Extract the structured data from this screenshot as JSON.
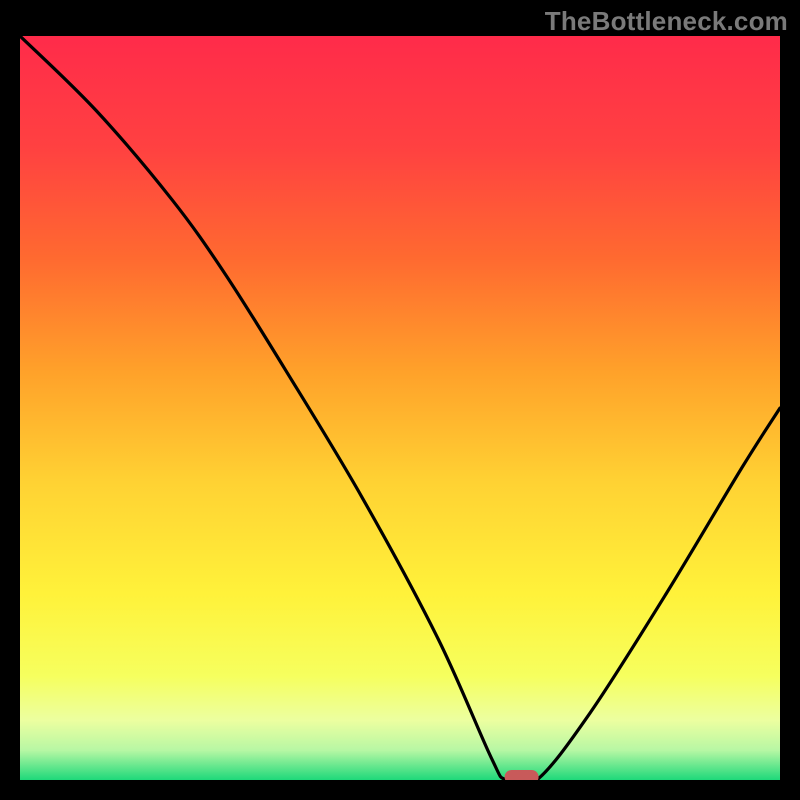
{
  "watermark": "TheBottleneck.com",
  "chart_data": {
    "type": "line",
    "title": "",
    "xlabel": "",
    "ylabel": "",
    "xlim": [
      0,
      100
    ],
    "ylim": [
      0,
      100
    ],
    "series": [
      {
        "name": "curve",
        "x": [
          0,
          10,
          20,
          27,
          35,
          45,
          55,
          62,
          64,
          68,
          75,
          85,
          95,
          100
        ],
        "values": [
          100,
          90,
          78,
          68,
          55,
          38,
          19,
          3,
          0,
          0,
          9,
          25,
          42,
          50
        ]
      }
    ],
    "marker": {
      "x": 66,
      "y": 0,
      "color": "#c85a5a"
    },
    "gradient": {
      "stops": [
        {
          "offset": 0,
          "color": "#ff2b4a"
        },
        {
          "offset": 0.15,
          "color": "#ff4141"
        },
        {
          "offset": 0.3,
          "color": "#ff6a30"
        },
        {
          "offset": 0.45,
          "color": "#ffa12a"
        },
        {
          "offset": 0.6,
          "color": "#ffd233"
        },
        {
          "offset": 0.75,
          "color": "#fff23a"
        },
        {
          "offset": 0.86,
          "color": "#f6ff5e"
        },
        {
          "offset": 0.92,
          "color": "#ecffa0"
        },
        {
          "offset": 0.96,
          "color": "#b7f7a4"
        },
        {
          "offset": 1.0,
          "color": "#1ed97a"
        }
      ]
    }
  }
}
